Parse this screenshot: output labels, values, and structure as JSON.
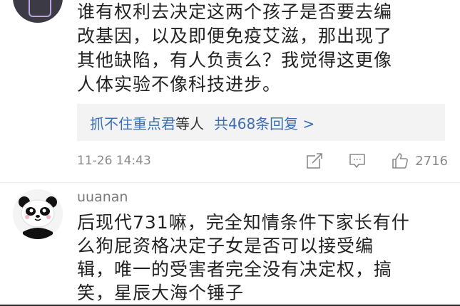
{
  "comment1": {
    "lines": [
      "谁有权利去决定这两个孩子是否要去编",
      "改基因，以及即便免疫艾滋，那出现了",
      "其他缺陷，有人负责么？我觉得这更像",
      "人体实验不像科技进步。"
    ],
    "reply_summary": {
      "user": "抓不住重点君",
      "suffix": "等人",
      "count_text": "共468条回复 >"
    },
    "time": "11-26 14:43",
    "likes": "2716",
    "icons": [
      "share-icon",
      "comment-icon",
      "like-icon"
    ]
  },
  "comment2": {
    "username": "uuanan",
    "lines": [
      "后现代731嘛，完全知情条件下家长有什",
      "么狗屁资格决定子女是否可以接受编",
      "辑，唯一的受害者完全没有决定权，搞",
      "笑，星辰大海个锤子"
    ]
  },
  "colors": {
    "link": "#3b6fb6",
    "meta": "#8a8a8a",
    "reply_bg": "#f3f3f3"
  }
}
